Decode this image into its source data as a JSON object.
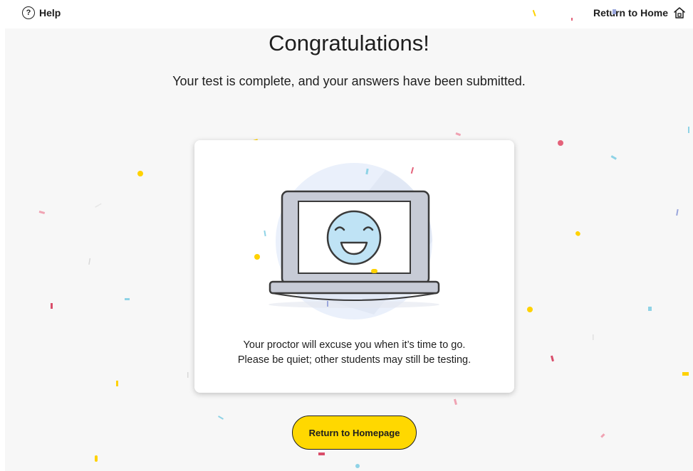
{
  "topbar": {
    "help_icon": "question-circle-icon",
    "help_glyph": "?",
    "help_label": "Help",
    "return_label": "Return to Home",
    "return_icon": "home-icon"
  },
  "main": {
    "title": "Congratulations!",
    "subtitle": "Your test is complete, and your answers have been submitted."
  },
  "card": {
    "illustration_icon": "smiling-laptop-icon",
    "line1": "Your proctor will excuse you when it’s time to go.",
    "line2": "Please be quiet; other students may still be testing."
  },
  "cta": {
    "label": "Return to Homepage"
  },
  "colors": {
    "accent": "#ffd800",
    "text": "#1e1e1e",
    "background": "#f7f7f7",
    "confetti": [
      "#ffd200",
      "#e4627a",
      "#8fd3e6",
      "#9aa6dc"
    ]
  }
}
